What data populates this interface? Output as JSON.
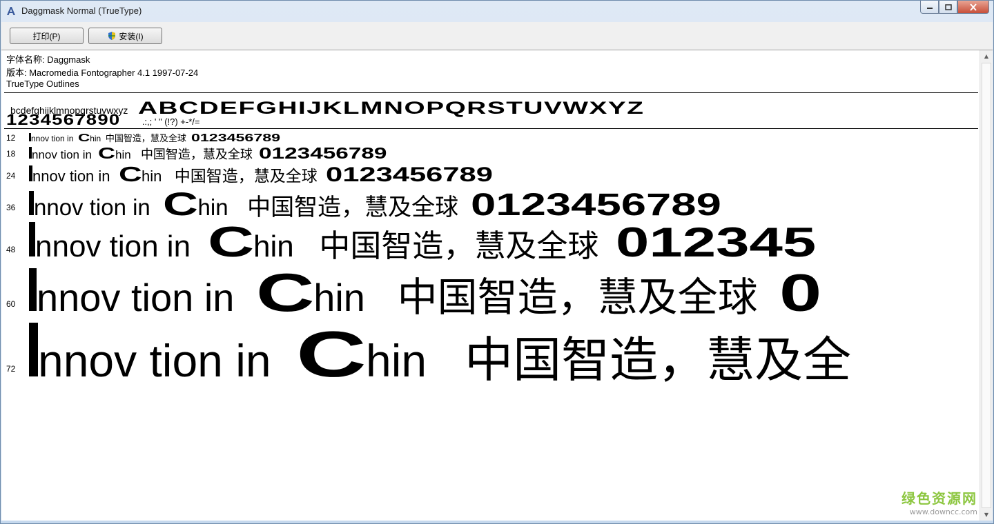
{
  "window": {
    "title": "Daggmask Normal (TrueType)"
  },
  "toolbar": {
    "print_label": "打印(P)",
    "install_label": "安装(I)"
  },
  "font_info": {
    "name_line": "字体名称: Daggmask",
    "version_line": "版本: Macromedia Fontographer 4.1 1997-07-24",
    "type_line": "TrueType Outlines"
  },
  "charset": {
    "lowercase": "bcdefghijklmnopqrstuvwxyz",
    "uppercase": "ABCDEFGHIJKLMNOPQRSTUVWXYZ",
    "digits": "1234567890",
    "punctuation": ".:,; ' \" (!?) +-*/="
  },
  "samples": [
    {
      "size": "12",
      "word1": "nnov tion  in",
      "word2": "hin",
      "cjk": "中国智造，慧及全球",
      "nums": "0123456789"
    },
    {
      "size": "18",
      "word1": "nnov tion  in",
      "word2": "hin",
      "cjk": "中国智造，慧及全球",
      "nums": "0123456789"
    },
    {
      "size": "24",
      "word1": "nnov tion  in",
      "word2": "hin",
      "cjk": "中国智造，慧及全球",
      "nums": "0123456789"
    },
    {
      "size": "36",
      "word1": "nnov tion  in",
      "word2": "hin",
      "cjk": "中国智造，慧及全球",
      "nums": "0123456789"
    },
    {
      "size": "48",
      "word1": "nnov tion  in",
      "word2": "hin",
      "cjk": "中国智造，慧及全球",
      "nums": "012345"
    },
    {
      "size": "60",
      "word1": "nnov tion  in",
      "word2": "hin",
      "cjk": "中国智造，慧及全球",
      "nums": "0"
    },
    {
      "size": "72",
      "word1": "nnov tion  in",
      "word2": "hin",
      "cjk": "中国智造，慧及全",
      "nums": ""
    }
  ],
  "sample_big_letter": "C",
  "watermark": {
    "name": "绿色资源网",
    "url": "www.downcc.com"
  }
}
